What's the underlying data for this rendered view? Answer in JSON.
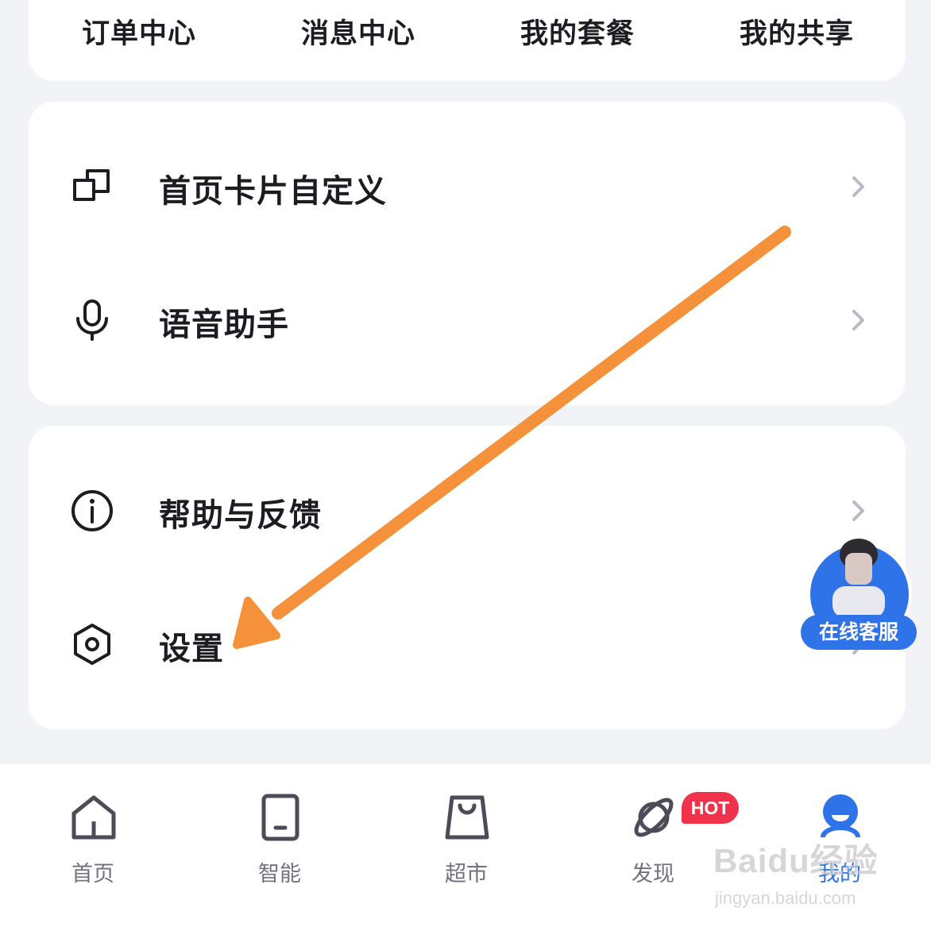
{
  "quick_links": [
    "订单中心",
    "消息中心",
    "我的套餐",
    "我的共享"
  ],
  "menu_group_1": [
    {
      "label": "首页卡片自定义",
      "icon": "cards-icon"
    },
    {
      "label": "语音助手",
      "icon": "microphone-icon"
    }
  ],
  "menu_group_2": [
    {
      "label": "帮助与反馈",
      "icon": "info-icon"
    },
    {
      "label": "设置",
      "icon": "settings-hexagon-icon"
    }
  ],
  "floating_service": {
    "label": "在线客服"
  },
  "tabbar": {
    "tabs": [
      {
        "label": "首页",
        "icon": "home-icon"
      },
      {
        "label": "智能",
        "icon": "tablet-icon"
      },
      {
        "label": "超市",
        "icon": "shopping-bag-icon"
      },
      {
        "label": "发现",
        "icon": "planet-icon"
      },
      {
        "label": "我的",
        "icon": "profile-icon"
      }
    ],
    "hot_badge": "HOT"
  },
  "watermark": {
    "main": "Baidu经验",
    "sub": "jingyan.baidu.com"
  },
  "colors": {
    "accent_blue": "#2f73e8",
    "hot_red": "#f0334a",
    "arrow_orange": "#f5913a",
    "background": "#f2f3f7"
  }
}
